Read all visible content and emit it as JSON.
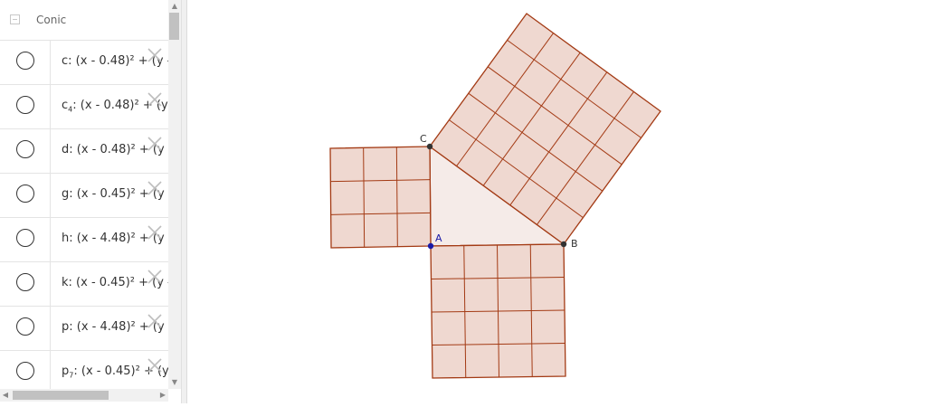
{
  "algebra": {
    "group_label": "Conic",
    "items": [
      {
        "name": "c",
        "sub": "",
        "expr": ": (x - 0.48)² + (y -"
      },
      {
        "name": "c",
        "sub": "4",
        "expr": ": (x - 0.48)² + (y -"
      },
      {
        "name": "d",
        "sub": "",
        "expr": ": (x - 0.48)² + (y -"
      },
      {
        "name": "g",
        "sub": "",
        "expr": ": (x - 0.45)² + (y -"
      },
      {
        "name": "h",
        "sub": "",
        "expr": ": (x - 4.48)² + (y -"
      },
      {
        "name": "k",
        "sub": "",
        "expr": ": (x - 0.45)² + (y -"
      },
      {
        "name": "p",
        "sub": "",
        "expr": ": (x - 4.48)² + (y -"
      },
      {
        "name": "p",
        "sub": "7",
        "expr": ": (x - 0.45)² + (y -"
      }
    ]
  },
  "points": {
    "A": "A",
    "B": "B",
    "C": "C"
  },
  "colors": {
    "square_fill": "#efd8d0",
    "square_line": "#a33a14",
    "triangle_fill": "#f5ebe8",
    "point_black": "#333333",
    "point_blue": "#1a1aa6"
  }
}
